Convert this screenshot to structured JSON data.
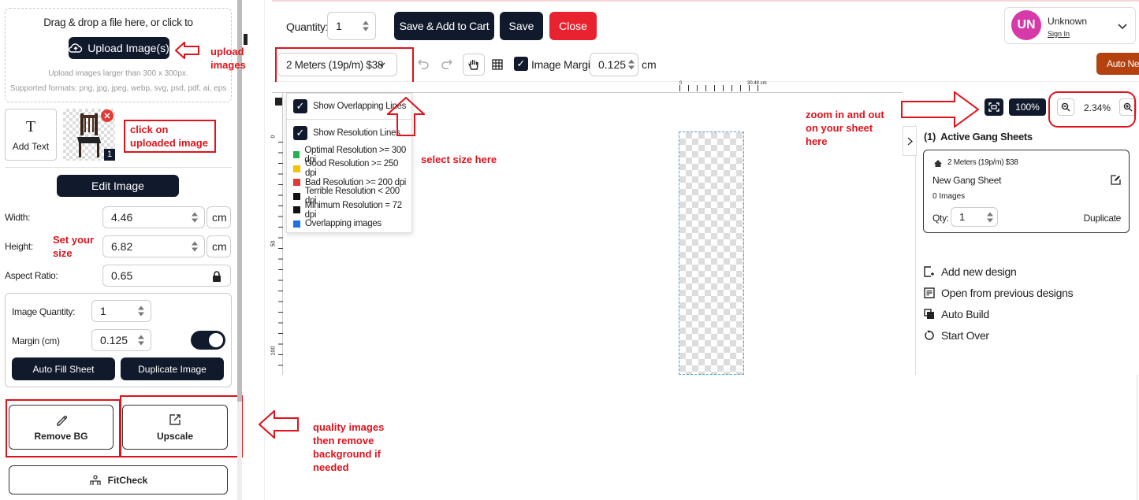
{
  "upload": {
    "drag_text": "Drag & drop a file here, or click to",
    "button_label": "Upload Image(s)",
    "hint_size": "Upload images larger than 300 x 300px.",
    "hint_formats": "Supported formats: png, jpg, jpeg, webp, svg, psd, pdf, ai, eps"
  },
  "add_text_label": "Add Text",
  "thumb_badge": "1",
  "edit_image_label": "Edit Image",
  "width": {
    "label": "Width:",
    "value": "4.46",
    "unit": "cm"
  },
  "height": {
    "label": "Height:",
    "value": "6.82",
    "unit": "cm"
  },
  "aspect": {
    "label": "Aspect Ratio:",
    "value": "0.65"
  },
  "image_quantity": {
    "label": "Image Quantity:",
    "value": "1"
  },
  "margin": {
    "label": "Margin (cm)",
    "value": "0.125",
    "toggle_on": true
  },
  "auto_fill_label": "Auto Fill Sheet",
  "duplicate_image_label": "Duplicate Image",
  "remove_bg_label": "Remove BG",
  "upscale_label": "Upscale",
  "fitcheck_label": "FitCheck",
  "topbar": {
    "quantity_label": "Quantity:",
    "quantity_value": "1",
    "save_add_label": "Save & Add to Cart",
    "save_label": "Save",
    "close_label": "Close"
  },
  "user": {
    "initials": "UN",
    "name": "Unknown",
    "sign_in": "Sign In"
  },
  "toolbar": {
    "size_select": "2 Meters (19p/m) $38",
    "image_margin_label": "Image Margin",
    "image_margin_value": "0.125",
    "image_margin_unit": "cm",
    "auto_nest_label": "Auto Nes"
  },
  "ruler": {
    "top_zero": "0",
    "top_mark": "30.48 cm",
    "left_zero": "0",
    "left_50": "50",
    "left_100": "100"
  },
  "overlay": {
    "show_overlapping": "Show Overlapping Lines",
    "show_resolution": "Show Resolution Lines",
    "legend": [
      {
        "color": "#22b14c",
        "label": "Optimal Resolution >= 300 dpi"
      },
      {
        "color": "#f2c300",
        "label": "Good Resolution >= 250 dpi"
      },
      {
        "color": "#e53935",
        "label": "Bad Resolution >= 200 dpi"
      },
      {
        "color": "#111111",
        "label": "Terrible Resolution < 200 dpi"
      },
      {
        "color": "#111111",
        "label": "Minimum Resolution = 72 dpi"
      },
      {
        "color": "#1e6fe8",
        "label": "Overlapping images"
      }
    ]
  },
  "zoom": {
    "fit_icon": "fit-screen-icon",
    "preset": "100%",
    "value": "2.34%"
  },
  "gang": {
    "header": "(1)  Active Gang Sheets",
    "card_title": "2 Meters (19p/m) $38",
    "sheet_name": "New Gang Sheet",
    "images_count": "0 Images",
    "qty_label": "Qty:",
    "qty_value": "1",
    "duplicate_label": "Duplicate"
  },
  "side_actions": [
    {
      "icon": "add-design-icon",
      "label": "Add new design"
    },
    {
      "icon": "open-designs-icon",
      "label": "Open from previous designs"
    },
    {
      "icon": "auto-build-icon",
      "label": "Auto Build"
    },
    {
      "icon": "start-over-icon",
      "label": "Start Over"
    }
  ],
  "annotations": {
    "upload": "upload images",
    "click_uploaded": "click on uploaded image",
    "set_size": "Set your size",
    "select_size": "select size here",
    "zoom": "zoom in and out on your sheet here",
    "quality": "quality images then remove background if needed"
  },
  "colors": {
    "dark": "#111a2c",
    "close_red": "#e8232f",
    "annotation_red": "#e0121b",
    "avatar": "#d63aa8",
    "auto_nest": "#b5410e"
  }
}
